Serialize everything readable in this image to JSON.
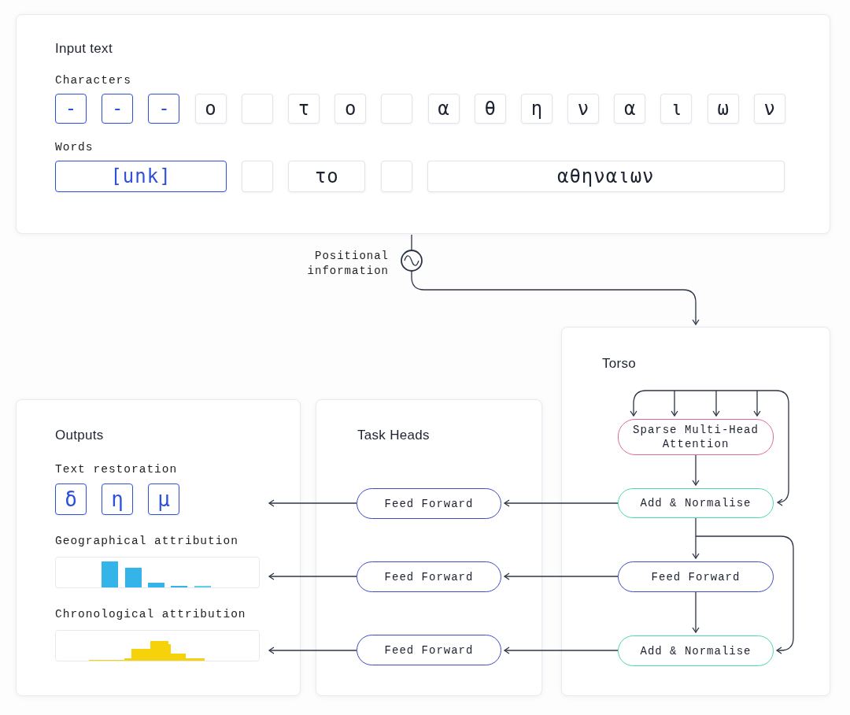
{
  "input_text": {
    "title": "Input text",
    "characters_label": "Characters",
    "characters": [
      {
        "kind": "char",
        "text": "-",
        "selected": true
      },
      {
        "kind": "char",
        "text": "-",
        "selected": true
      },
      {
        "kind": "char",
        "text": "-",
        "selected": true
      },
      {
        "kind": "char",
        "text": "ο",
        "selected": false
      },
      {
        "kind": "blank",
        "selected": false
      },
      {
        "kind": "char",
        "text": "τ",
        "selected": false
      },
      {
        "kind": "char",
        "text": "ο",
        "selected": false
      },
      {
        "kind": "blank",
        "selected": false
      },
      {
        "kind": "char",
        "text": "α",
        "selected": false
      },
      {
        "kind": "char",
        "text": "θ",
        "selected": false
      },
      {
        "kind": "char",
        "text": "η",
        "selected": false
      },
      {
        "kind": "char",
        "text": "ν",
        "selected": false
      },
      {
        "kind": "char",
        "text": "α",
        "selected": false
      },
      {
        "kind": "char",
        "text": "ι",
        "selected": false
      },
      {
        "kind": "char",
        "text": "ω",
        "selected": false
      },
      {
        "kind": "char",
        "text": "ν",
        "selected": false
      }
    ],
    "words_label": "Words",
    "words": [
      {
        "kind": "word",
        "text": "[unk]",
        "selected": true
      },
      {
        "kind": "blank",
        "selected": false
      },
      {
        "kind": "word",
        "text": "το",
        "selected": false
      },
      {
        "kind": "blank",
        "selected": false
      },
      {
        "kind": "word",
        "text": "αθηναιων",
        "selected": false
      }
    ]
  },
  "positional": {
    "label": "Positional information"
  },
  "torso": {
    "title": "Torso",
    "nodes": [
      {
        "label": "Sparse Multi-Head Attention",
        "color": "#e0699b"
      },
      {
        "label": "Add & Normalise",
        "color": "#4fd8b0"
      },
      {
        "label": "Feed Forward",
        "color": "#3b4cc0"
      },
      {
        "label": "Add & Normalise",
        "color": "#4fd8b0"
      }
    ]
  },
  "task_heads": {
    "title": "Task Heads",
    "nodes": [
      {
        "label": "Feed Forward",
        "color": "#3b4cc0"
      },
      {
        "label": "Feed Forward",
        "color": "#3b4cc0"
      },
      {
        "label": "Feed Forward",
        "color": "#3b4cc0"
      }
    ]
  },
  "outputs": {
    "title": "Outputs",
    "text_restoration": {
      "label": "Text restoration",
      "characters": [
        {
          "text": "δ"
        },
        {
          "text": "η"
        },
        {
          "text": "μ"
        }
      ]
    },
    "geographical": {
      "label": "Geographical attribution"
    },
    "chronological": {
      "label": "Chronological attribution"
    }
  }
}
